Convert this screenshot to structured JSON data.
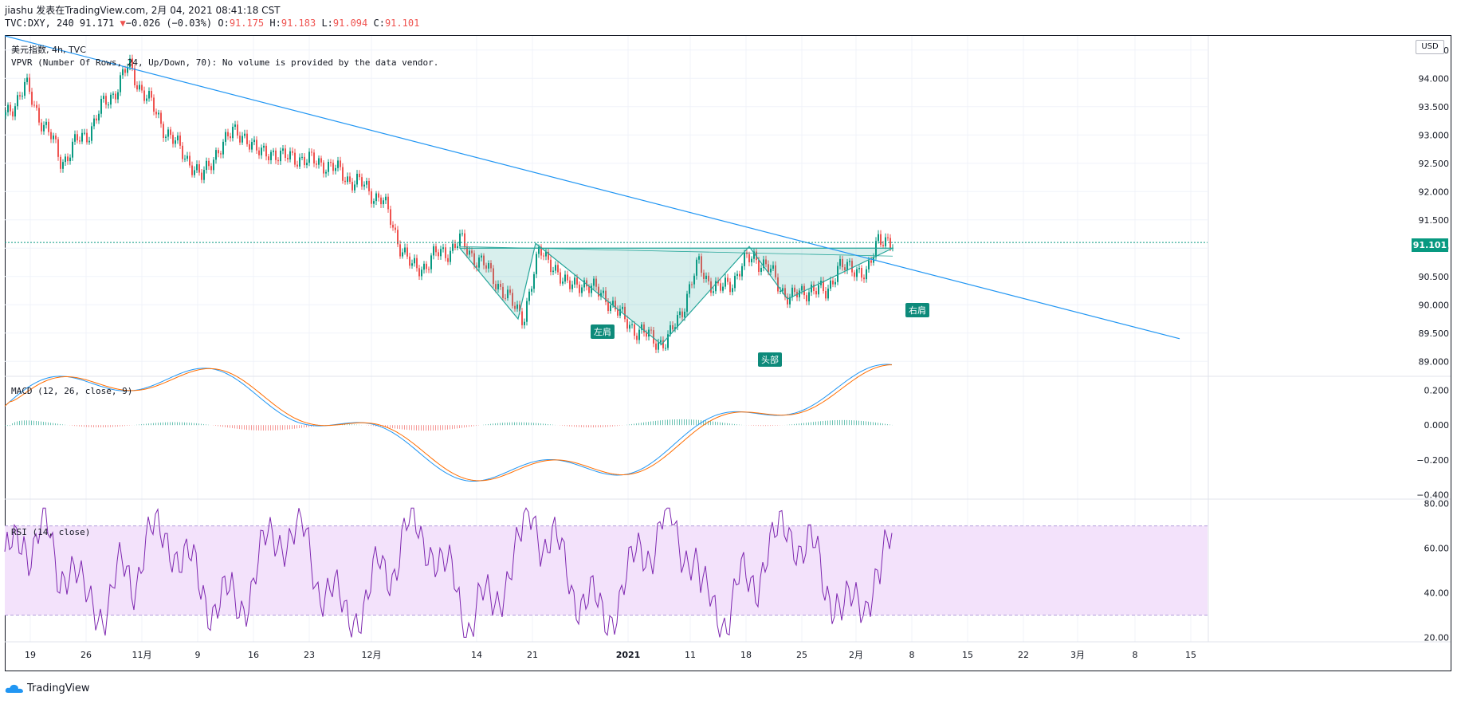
{
  "header": {
    "author_line": "jiashu 发表在TradingView.com, 2月 04, 2021 08:41:18 CST",
    "symbol_line_prefix": "TVC:DXY, 240 91.171",
    "change_arrow": "▼",
    "change": "−0.026 (−0.03%)",
    "o_label": "O:",
    "o_value": "91.175",
    "h_label": "H:",
    "h_value": "91.183",
    "l_label": "L:",
    "l_value": "91.094",
    "c_label": "C:",
    "c_value": "91.101"
  },
  "pane_titles": {
    "main": "美元指数, 4h, TVC",
    "vpvr": "VPVR (Number Of Rows, 24, Up/Down, 70): No volume is provided by the data vendor.",
    "macd": "MACD (12, 26, close, 9)",
    "rsi": "RSI (14, close)"
  },
  "currency_button": "USD",
  "last_price": "91.101",
  "pattern_labels": {
    "left_shoulder": "左肩",
    "head": "头部",
    "right_shoulder": "右肩"
  },
  "logo_text": "TradingView",
  "colors": {
    "up": "#089981",
    "down": "#ef5350",
    "trend": "#2196f3",
    "fill": "#26a69a",
    "macd": "#2196f3",
    "signal": "#ff6d00",
    "rsi": "#7e27b0",
    "rsi_band": "#f3e2fb"
  },
  "chart_data": {
    "type": "candlestick",
    "title": "美元指数, 4h, TVC",
    "x_ticks": [
      "19",
      "26",
      "11月",
      "9",
      "16",
      "23",
      "12月",
      "14",
      "21",
      "2021",
      "11",
      "18",
      "25",
      "2月",
      "8",
      "15",
      "22",
      "3月",
      "8",
      "15"
    ],
    "price_axis": {
      "ticks": [
        "94.500",
        "94.000",
        "93.500",
        "93.000",
        "92.500",
        "92.000",
        "91.500",
        "91.000",
        "90.500",
        "90.000",
        "89.500",
        "89.000"
      ],
      "range": [
        88.75,
        94.75
      ]
    },
    "last_price": 91.101,
    "price_anchors": [
      [
        0,
        93.35
      ],
      [
        25,
        93.85
      ],
      [
        70,
        92.55
      ],
      [
        100,
        93.0
      ],
      [
        155,
        94.2
      ],
      [
        200,
        93.1
      ],
      [
        245,
        92.25
      ],
      [
        285,
        93.1
      ],
      [
        320,
        92.7
      ],
      [
        400,
        92.5
      ],
      [
        470,
        91.9
      ],
      [
        510,
        90.6
      ],
      [
        570,
        91.1
      ],
      [
        600,
        90.7
      ],
      [
        650,
        89.75
      ],
      [
        670,
        91.0
      ],
      [
        700,
        90.4
      ],
      [
        740,
        90.3
      ],
      [
        790,
        89.55
      ],
      [
        830,
        89.3
      ],
      [
        870,
        90.7
      ],
      [
        895,
        90.2
      ],
      [
        940,
        90.9
      ],
      [
        985,
        90.1
      ],
      [
        1010,
        90.3
      ],
      [
        1030,
        90.2
      ],
      [
        1045,
        90.7
      ],
      [
        1080,
        90.55
      ],
      [
        1095,
        91.15
      ],
      [
        1113,
        91.1
      ]
    ],
    "trendline": {
      "from": [
        6,
        94.75
      ],
      "to": [
        1480,
        89.4
      ]
    },
    "neckline_level": 91.0,
    "macd_axis": {
      "ticks": [
        "0.200",
        "0.000",
        "−0.200",
        "−0.400"
      ],
      "range": [
        -0.42,
        0.28
      ]
    },
    "rsi_axis": {
      "ticks": [
        "80.00",
        "60.00",
        "40.00",
        "20.00"
      ],
      "range": [
        18,
        82
      ],
      "band": [
        30,
        70
      ]
    }
  }
}
